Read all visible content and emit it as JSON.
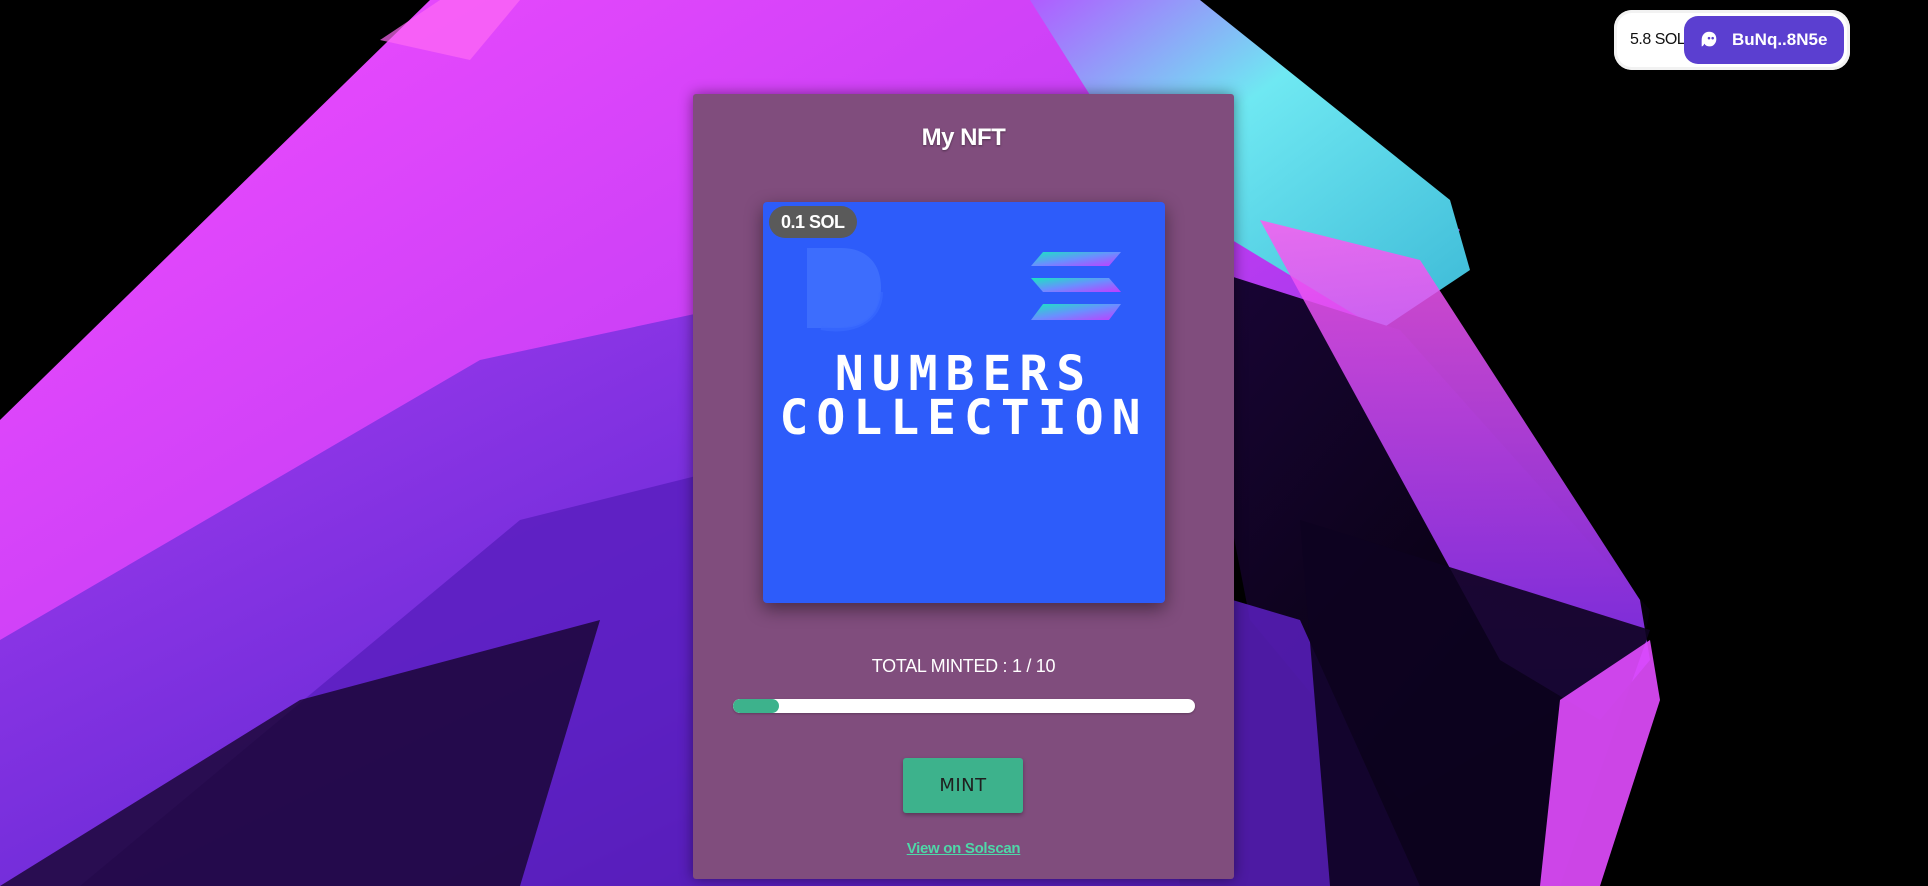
{
  "wallet": {
    "balance": "5.8 SOL",
    "address": "BuNq..8N5e",
    "icon": "phantom-ghost-icon",
    "button_color": "#5b3fd0"
  },
  "card": {
    "title": "My NFT",
    "background_color": "#804d7d",
    "nft": {
      "price": "0.1 SOL",
      "title": "NUMBERS\nCOLLECTION",
      "background_color": "#2d5cfa",
      "icons": [
        "d-logo-icon",
        "solana-logo-icon"
      ]
    },
    "minted": {
      "label": "TOTAL MINTED : 1 / 10",
      "current": 1,
      "total": 10,
      "progress_fraction": 0.1,
      "fill_color": "#3db28c"
    },
    "mint_button": "MINT",
    "solscan_link": "View on Solscan"
  },
  "background": {
    "colors": [
      "#e63cff",
      "#8a2be2",
      "#6ef0f0",
      "#000000"
    ]
  }
}
